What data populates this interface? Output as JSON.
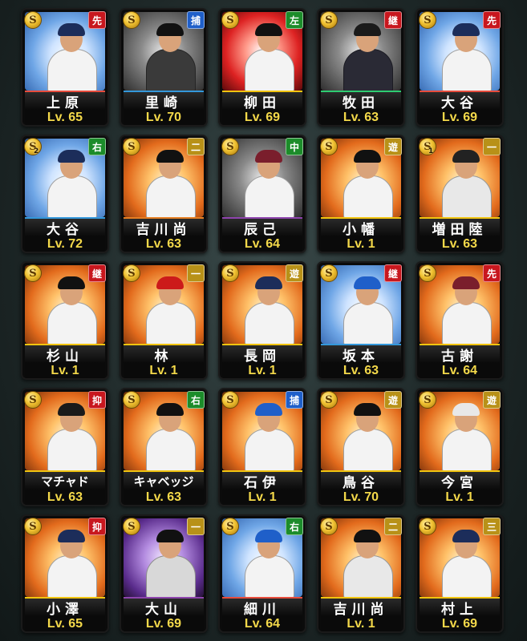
{
  "colors": {
    "pos_red": "#c8171e",
    "pos_blue": "#1f5fc9",
    "pos_green": "#1c8c2a",
    "pos_gold": "#b89118",
    "level_text": "#f4d94a"
  },
  "coin_label": "S",
  "cards": [
    {
      "name": "上原",
      "pos": "先",
      "pos_color": "#c8171e",
      "level": "Lv. 65",
      "bg": "bg-sky",
      "stripe": "#e74c3c",
      "cap": "#1c2d5a",
      "uniform": "#f3f3f3",
      "badge": ""
    },
    {
      "name": "里崎",
      "pos": "捕",
      "pos_color": "#1f5fc9",
      "level": "Lv. 70",
      "bg": "bg-dark",
      "stripe": "#3498db",
      "cap": "#111",
      "uniform": "#3a3a3a",
      "badge": ""
    },
    {
      "name": "柳田",
      "pos": "左",
      "pos_color": "#1c8c2a",
      "level": "Lv. 69",
      "bg": "bg-red",
      "stripe": "#f1c40f",
      "cap": "#111",
      "uniform": "#f3f3f3",
      "badge": ""
    },
    {
      "name": "牧田",
      "pos": "継",
      "pos_color": "#c8171e",
      "level": "Lv. 63",
      "bg": "bg-dark",
      "stripe": "#2ecc71",
      "cap": "#1a1a1a",
      "uniform": "#2a2a35",
      "badge": ""
    },
    {
      "name": "大谷",
      "pos": "先",
      "pos_color": "#c8171e",
      "level": "Lv. 69",
      "bg": "bg-sky",
      "stripe": "#e74c3c",
      "cap": "#1c2d5a",
      "uniform": "#f3f3f3",
      "badge": ""
    },
    {
      "name": "大谷",
      "pos": "右",
      "pos_color": "#1c8c2a",
      "level": "Lv. 72",
      "bg": "bg-sky",
      "stripe": "#3498db",
      "cap": "#1c2d5a",
      "uniform": "#f3f3f3",
      "badge": "2"
    },
    {
      "name": "吉川尚",
      "pos": "二",
      "pos_color": "#b89118",
      "level": "Lv. 63",
      "bg": "bg-fire",
      "stripe": "#e67e22",
      "cap": "#111",
      "uniform": "#f3f3f3",
      "badge": ""
    },
    {
      "name": "辰己",
      "pos": "中",
      "pos_color": "#1c8c2a",
      "level": "Lv. 64",
      "bg": "bg-dark",
      "stripe": "#8e44ad",
      "cap": "#7a1e2c",
      "uniform": "#f3f3f3",
      "badge": ""
    },
    {
      "name": "小幡",
      "pos": "遊",
      "pos_color": "#b89118",
      "level": "Lv. 1",
      "bg": "bg-fire",
      "stripe": "#f1c40f",
      "cap": "#111",
      "uniform": "#f3f3f3",
      "badge": ""
    },
    {
      "name": "増田陸",
      "pos": "一",
      "pos_color": "#b89118",
      "level": "Lv. 63",
      "bg": "bg-fire",
      "stripe": "#f1c40f",
      "cap": "#222",
      "uniform": "#e8e8e8",
      "badge": "1"
    },
    {
      "name": "杉山",
      "pos": "継",
      "pos_color": "#c8171e",
      "level": "Lv. 1",
      "bg": "bg-fire",
      "stripe": "#f1c40f",
      "cap": "#111",
      "uniform": "#f3f3f3",
      "badge": ""
    },
    {
      "name": "林",
      "pos": "一",
      "pos_color": "#b89118",
      "level": "Lv. 1",
      "bg": "bg-fire",
      "stripe": "#f1c40f",
      "cap": "#cc1a1a",
      "uniform": "#f3f3f3",
      "badge": ""
    },
    {
      "name": "長岡",
      "pos": "遊",
      "pos_color": "#b89118",
      "level": "Lv. 1",
      "bg": "bg-fire",
      "stripe": "#f1c40f",
      "cap": "#1c2d5a",
      "uniform": "#f3f3f3",
      "badge": ""
    },
    {
      "name": "坂本",
      "pos": "継",
      "pos_color": "#c8171e",
      "level": "Lv. 63",
      "bg": "bg-sky",
      "stripe": "#3498db",
      "cap": "#1f5fc9",
      "uniform": "#f3f3f3",
      "badge": ""
    },
    {
      "name": "古謝",
      "pos": "先",
      "pos_color": "#c8171e",
      "level": "Lv. 64",
      "bg": "bg-fire",
      "stripe": "#f1c40f",
      "cap": "#7a1e2c",
      "uniform": "#f3f3f3",
      "badge": ""
    },
    {
      "name": "マチャド",
      "pos": "抑",
      "pos_color": "#c8171e",
      "level": "Lv. 63",
      "bg": "bg-fire",
      "stripe": "#f1c40f",
      "cap": "#1a1a1a",
      "uniform": "#f3f3f3",
      "badge": ""
    },
    {
      "name": "キャベッジ",
      "pos": "右",
      "pos_color": "#1c8c2a",
      "level": "Lv. 63",
      "bg": "bg-fire",
      "stripe": "#f1c40f",
      "cap": "#111",
      "uniform": "#f3f3f3",
      "badge": ""
    },
    {
      "name": "石伊",
      "pos": "捕",
      "pos_color": "#1f5fc9",
      "level": "Lv. 1",
      "bg": "bg-fire",
      "stripe": "#f1c40f",
      "cap": "#1f5fc9",
      "uniform": "#f3f3f3",
      "badge": ""
    },
    {
      "name": "鳥谷",
      "pos": "遊",
      "pos_color": "#b89118",
      "level": "Lv. 70",
      "bg": "bg-fire",
      "stripe": "#f1c40f",
      "cap": "#111",
      "uniform": "#f3f3f3",
      "badge": ""
    },
    {
      "name": "今宮",
      "pos": "遊",
      "pos_color": "#b89118",
      "level": "Lv. 1",
      "bg": "bg-fire",
      "stripe": "#f1c40f",
      "cap": "#e8e8e8",
      "uniform": "#f3f3f3",
      "badge": ""
    },
    {
      "name": "小澤",
      "pos": "抑",
      "pos_color": "#c8171e",
      "level": "Lv. 65",
      "bg": "bg-fire",
      "stripe": "#f1c40f",
      "cap": "#1c2d5a",
      "uniform": "#f3f3f3",
      "badge": ""
    },
    {
      "name": "大山",
      "pos": "一",
      "pos_color": "#b89118",
      "level": "Lv. 69",
      "bg": "bg-purple",
      "stripe": "#8e44ad",
      "cap": "#111",
      "uniform": "#d8d8d8",
      "badge": ""
    },
    {
      "name": "細川",
      "pos": "右",
      "pos_color": "#1c8c2a",
      "level": "Lv. 64",
      "bg": "bg-sky",
      "stripe": "#e74c3c",
      "cap": "#1f5fc9",
      "uniform": "#f3f3f3",
      "badge": ""
    },
    {
      "name": "吉川尚",
      "pos": "二",
      "pos_color": "#b89118",
      "level": "Lv. 1",
      "bg": "bg-fire",
      "stripe": "#f1c40f",
      "cap": "#111",
      "uniform": "#e8e8e8",
      "badge": ""
    },
    {
      "name": "村上",
      "pos": "三",
      "pos_color": "#b89118",
      "level": "Lv. 69",
      "bg": "bg-fire",
      "stripe": "#f1c40f",
      "cap": "#1c2d5a",
      "uniform": "#f3f3f3",
      "badge": ""
    }
  ]
}
